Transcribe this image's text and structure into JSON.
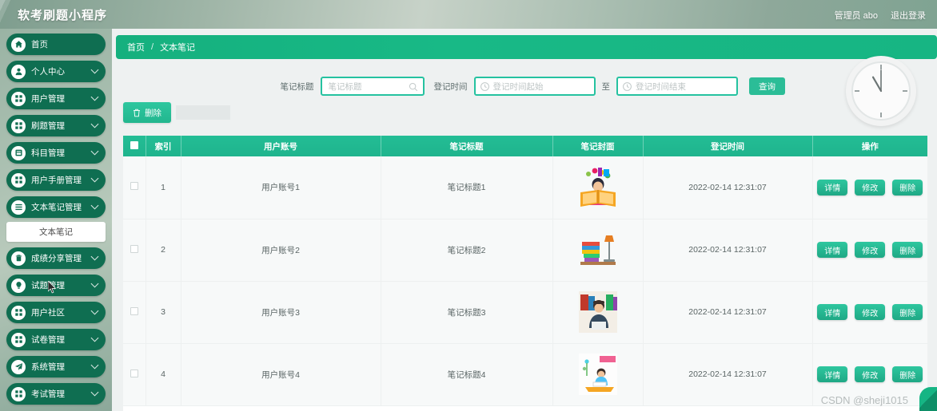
{
  "app": {
    "title": "软考刷题小程序",
    "accent": "#15b07e",
    "sidebar_active": "#0f6e51"
  },
  "topbar": {
    "user": "管理员 abo",
    "logout": "退出登录"
  },
  "sidebar": {
    "items": [
      {
        "label": "首页",
        "icon": "home-icon",
        "expandable": false
      },
      {
        "label": "个人中心",
        "icon": "user-icon",
        "expandable": true
      },
      {
        "label": "用户管理",
        "icon": "grid-icon",
        "expandable": true
      },
      {
        "label": "刷题管理",
        "icon": "grid-icon",
        "expandable": true
      },
      {
        "label": "科目管理",
        "icon": "book-icon",
        "expandable": true
      },
      {
        "label": "用户手册管理",
        "icon": "grid-icon",
        "expandable": true
      },
      {
        "label": "文本笔记管理",
        "icon": "list-icon",
        "expandable": true
      },
      {
        "label": "成绩分享管理",
        "icon": "trash-icon",
        "expandable": true
      },
      {
        "label": "试题管理",
        "icon": "bulb-icon",
        "expandable": true
      },
      {
        "label": "用户社区",
        "icon": "grid-icon",
        "expandable": true
      },
      {
        "label": "试卷管理",
        "icon": "grid-icon",
        "expandable": true
      },
      {
        "label": "系统管理",
        "icon": "send-icon",
        "expandable": true
      },
      {
        "label": "考试管理",
        "icon": "grid-icon",
        "expandable": true
      }
    ],
    "submenu": {
      "label": "文本笔记",
      "parent_index": 6
    }
  },
  "breadcrumb": {
    "root": "首页",
    "separator": "/",
    "current": "文本笔记"
  },
  "search": {
    "title_label": "笔记标题",
    "title_placeholder": "笔记标题",
    "title_value": "",
    "date_label": "登记时间",
    "date_start_placeholder": "登记时间起始",
    "date_start_value": "",
    "range_separator": "至",
    "date_end_placeholder": "登记时间结束",
    "date_end_value": "",
    "query_button": "查询"
  },
  "toolbar": {
    "delete_button": "删除",
    "delete_icon": "trash-icon"
  },
  "clock": {
    "name": "analog-clock",
    "hour": 11,
    "minute": 0
  },
  "table": {
    "headers": [
      "",
      "索引",
      "用户账号",
      "笔记标题",
      "笔记封面",
      "登记时间",
      "操作"
    ],
    "header_checkbox_checked": true,
    "rows": [
      {
        "checked": false,
        "index": "1",
        "account": "用户账号1",
        "note_title": "笔记标题1",
        "cover": "child-reading-book",
        "register_time": "2022-02-14 12:31:07"
      },
      {
        "checked": false,
        "index": "2",
        "account": "用户账号2",
        "note_title": "笔记标题2",
        "cover": "books-and-lamp",
        "register_time": "2022-02-14 12:31:07"
      },
      {
        "checked": false,
        "index": "3",
        "account": "用户账号3",
        "note_title": "笔记标题3",
        "cover": "man-with-books",
        "register_time": "2022-02-14 12:31:07"
      },
      {
        "checked": false,
        "index": "4",
        "account": "用户账号4",
        "note_title": "笔记标题4",
        "cover": "student-studying",
        "register_time": "2022-02-14 12:31:07"
      }
    ],
    "ops": [
      "详情",
      "修改",
      "删除"
    ]
  },
  "watermark": "CSDN @sheji1015"
}
